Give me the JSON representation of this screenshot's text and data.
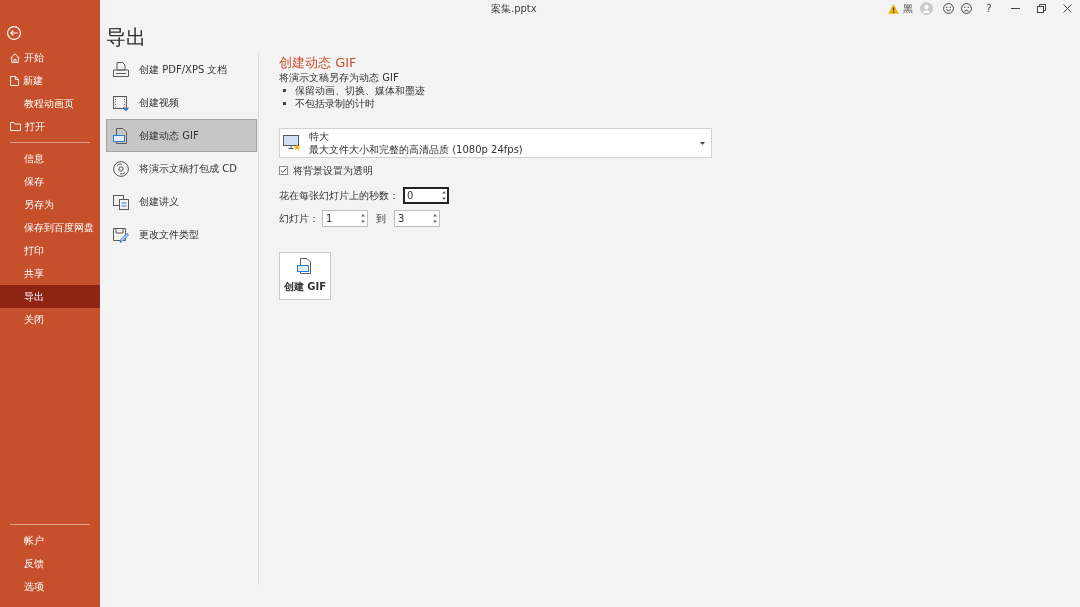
{
  "window": {
    "title": "案集.pptx",
    "account_name": "黑",
    "help_button": "?"
  },
  "sidebar": {
    "top_items": [
      {
        "label": "开始",
        "selected": false
      },
      {
        "label": "新建",
        "selected": false
      },
      {
        "label": "教程动画页",
        "selected": false
      },
      {
        "label": "打开",
        "selected": false
      }
    ],
    "main_items": [
      {
        "label": "信息",
        "selected": false
      },
      {
        "label": "保存",
        "selected": false
      },
      {
        "label": "另存为",
        "selected": false
      },
      {
        "label": "保存到百度网盘",
        "selected": false
      },
      {
        "label": "打印",
        "selected": false
      },
      {
        "label": "共享",
        "selected": false
      },
      {
        "label": "导出",
        "selected": true
      },
      {
        "label": "关闭",
        "selected": false
      }
    ],
    "bottom_items": [
      {
        "label": "帐户",
        "selected": false
      },
      {
        "label": "反馈",
        "selected": false
      },
      {
        "label": "选项",
        "selected": false
      }
    ]
  },
  "page_title": "导出",
  "export_options": [
    {
      "label": "创建 PDF/XPS 文档",
      "selected": false
    },
    {
      "label": "创建视频",
      "selected": false
    },
    {
      "label": "创建动态 GIF",
      "selected": true
    },
    {
      "label": "将演示文稿打包成 CD",
      "selected": false
    },
    {
      "label": "创建讲义",
      "selected": false
    },
    {
      "label": "更改文件类型",
      "selected": false
    }
  ],
  "detail": {
    "title": "创建动态 GIF",
    "description": "将演示文稿另存为动态 GIF",
    "bullets": [
      "保留动画、切换、媒体和墨迹",
      "不包括录制的计时"
    ],
    "quality": {
      "label": "特大",
      "description": "最大文件大小和完整的高清品质 (1080p 24fps)"
    },
    "transparent_background": {
      "label": "将背景设置为透明",
      "checked": true
    },
    "seconds_per_slide": {
      "label": "花在每张幻灯片上的秒数：",
      "value": "0",
      "focused": true
    },
    "slide_range": {
      "label": "幻灯片：",
      "from": "1",
      "to_label": "到",
      "to": "3"
    },
    "create_button": {
      "label": "创建 GIF"
    }
  }
}
